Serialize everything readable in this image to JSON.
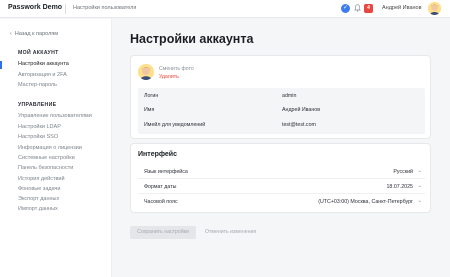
{
  "header": {
    "brand": "Passwork Demo",
    "section": "Настройки пользователя",
    "check_icon": "check-circle-icon",
    "notifications_count": "4",
    "user_name": "Андрей Иванов",
    "accent_color": "#2f6fe8",
    "alert_color": "#e8463e"
  },
  "sidebar": {
    "back_label": "Назад к паролям",
    "account_group": {
      "title": "МОЙ АККАУНТ",
      "items": [
        "Настройки аккаунта",
        "Авторизация и 2FA",
        "Мастер-пароль"
      ],
      "active_index": 0
    },
    "manage_group": {
      "title": "УПРАВЛЕНИЕ",
      "items": [
        "Управление пользователями",
        "Настройки LDAP",
        "Настройки SSO",
        "Информация о лицензии",
        "Системные настройки",
        "Панель безопасности",
        "История действий",
        "Фоновые задачи",
        "Экспорт данных",
        "Импорт данных"
      ]
    }
  },
  "main": {
    "title": "Настройки аккаунта",
    "profile": {
      "change_photo": "Сменить фото",
      "delete_photo": "Удалить",
      "fields": [
        {
          "label": "Логин",
          "value": "admin"
        },
        {
          "label": "Имя",
          "value": "Андрей Иванов"
        },
        {
          "label": "Имейл для уведомлений",
          "value": "test@test.com"
        }
      ]
    },
    "interface": {
      "title": "Интерфейс",
      "fields": [
        {
          "label": "Язык интерфейса",
          "value": "Русский"
        },
        {
          "label": "Формат даты",
          "value": "18.07.2025"
        },
        {
          "label": "Часовой пояс",
          "value": "(UTC+03:00) Москва, Санкт-Петербург"
        }
      ]
    },
    "save_label": "Сохранить настройки",
    "cancel_label": "Отменить изменения"
  }
}
